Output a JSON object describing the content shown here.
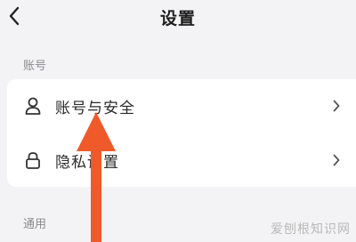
{
  "header": {
    "back_icon": "chevron-left-icon",
    "title": "设置"
  },
  "sections": {
    "account_label": "账号",
    "general_label": "通用"
  },
  "account_card": {
    "items": [
      {
        "label": "账号与安全",
        "icon": "person-icon",
        "chevron": "chevron-right-icon"
      },
      {
        "label": "隐私设置",
        "icon": "lock-icon",
        "chevron": "chevron-right-icon"
      }
    ]
  },
  "annotation": {
    "arrow_color": "#f05a2a",
    "arrow_icon": "arrow-up-icon"
  },
  "watermark": "爱刨根知识网"
}
